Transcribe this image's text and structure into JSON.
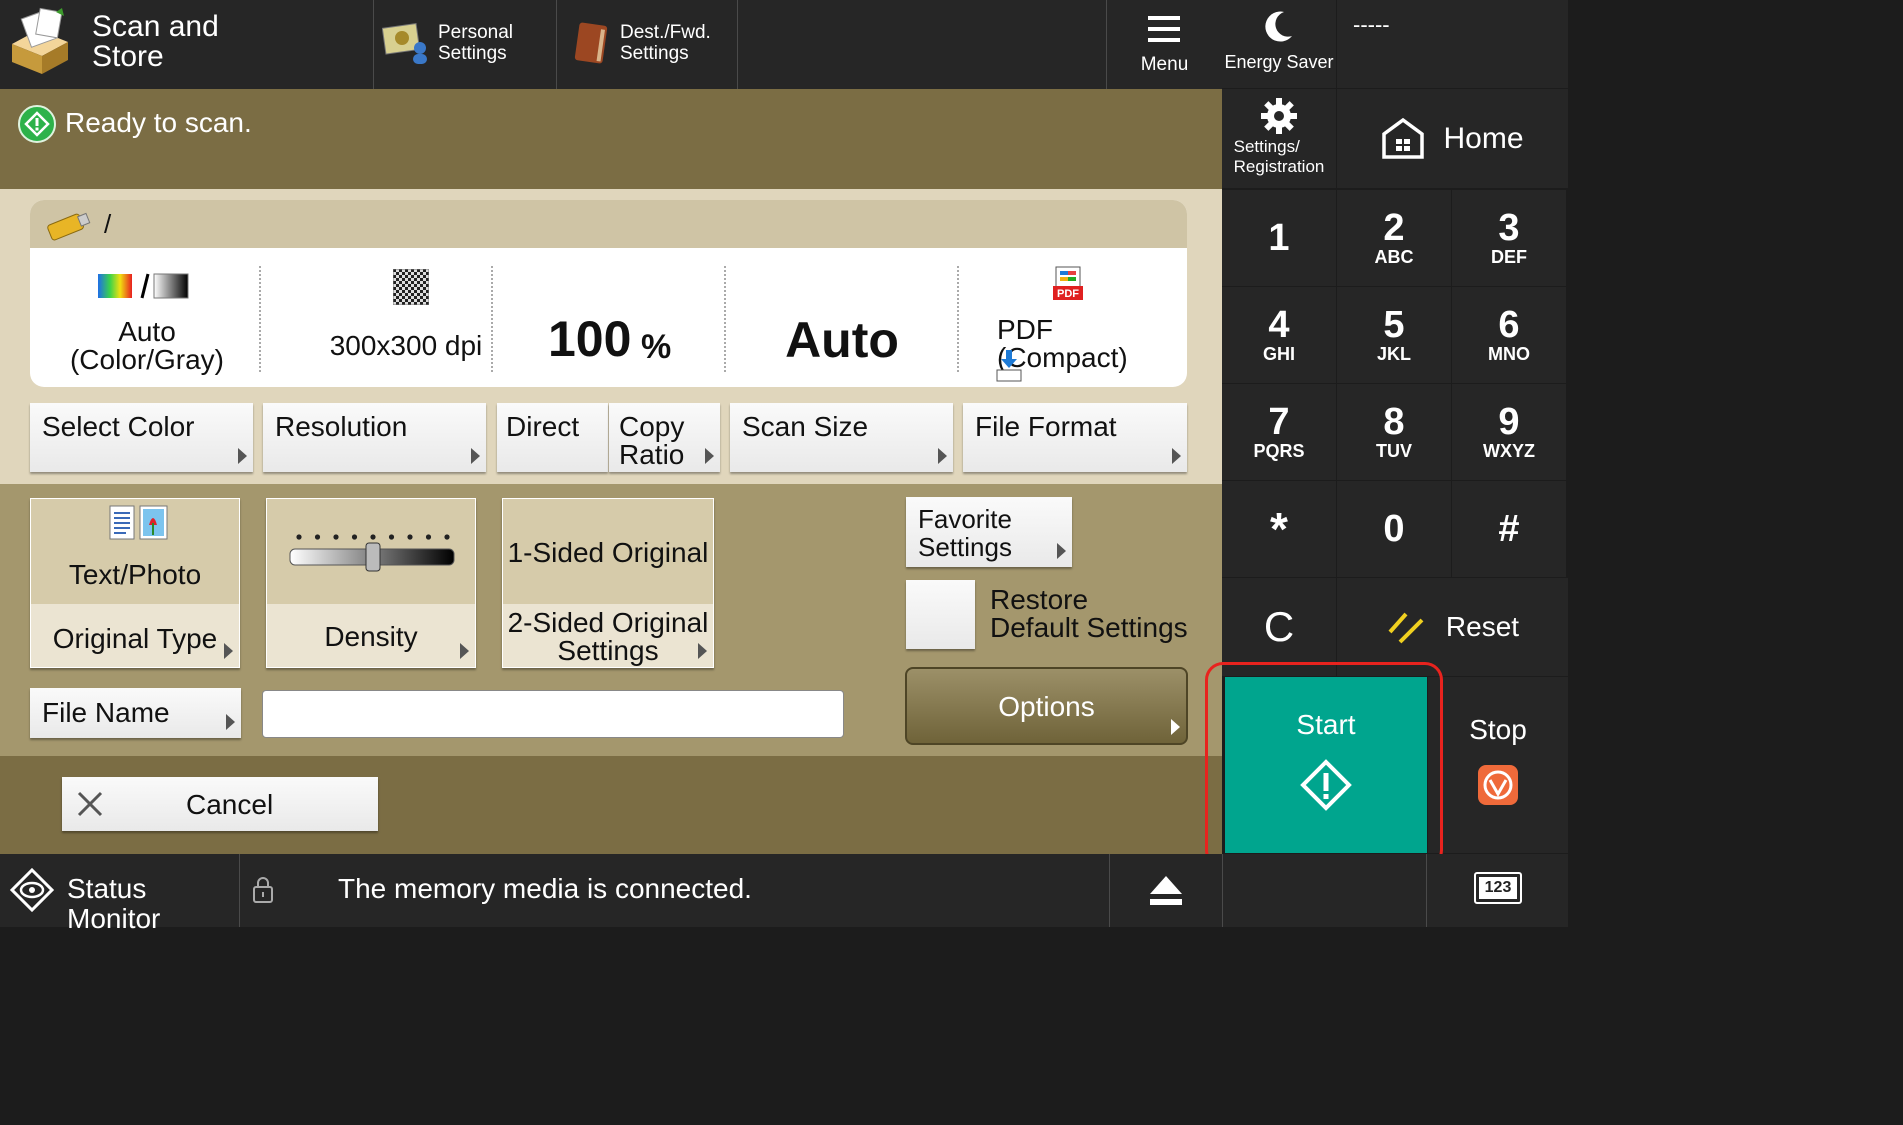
{
  "app_title": "Scan and\nStore",
  "header": {
    "personal_settings": "Personal\nSettings",
    "dest_fwd_settings": "Dest./Fwd.\nSettings",
    "menu": "Menu",
    "energy_saver": "Energy Saver",
    "user_field": "-----",
    "settings_registration": "Settings/\nRegistration",
    "home": "Home"
  },
  "status_message": "Ready to scan.",
  "path": "/",
  "summary": {
    "color": "Auto\n(Color/Gray)",
    "resolution": "300x300 dpi",
    "ratio_value": "100",
    "ratio_unit": "%",
    "scan_size": "Auto",
    "file_format": "PDF (Compact)"
  },
  "setting_buttons": {
    "select_color": "Select Color",
    "resolution": "Resolution",
    "direct": "Direct",
    "copy_ratio": "Copy\nRatio",
    "scan_size": "Scan Size",
    "file_format": "File Format"
  },
  "original_type": {
    "value": "Text/Photo",
    "label": "Original Type"
  },
  "density": {
    "label": "Density",
    "level": 0.5
  },
  "sided": {
    "value": "1-Sided Original",
    "label": "2-Sided Original\nSettings"
  },
  "favorite_settings": "Favorite\nSettings",
  "restore_default": "Restore\nDefault Settings",
  "file_name_button": "File Name",
  "file_name_value": "",
  "options": "Options",
  "cancel": "Cancel",
  "keypad": [
    {
      "n": "1",
      "s": ""
    },
    {
      "n": "2",
      "s": "ABC"
    },
    {
      "n": "3",
      "s": "DEF"
    },
    {
      "n": "4",
      "s": "GHI"
    },
    {
      "n": "5",
      "s": "JKL"
    },
    {
      "n": "6",
      "s": "MNO"
    },
    {
      "n": "7",
      "s": "PQRS"
    },
    {
      "n": "8",
      "s": "TUV"
    },
    {
      "n": "9",
      "s": "WXYZ"
    },
    {
      "n": "*",
      "s": ""
    },
    {
      "n": "0",
      "s": ""
    },
    {
      "n": "#",
      "s": ""
    }
  ],
  "clear": "C",
  "reset": "Reset",
  "start": "Start",
  "stop": "Stop",
  "status_monitor": "Status Monitor",
  "memory_message": "The memory media is connected.",
  "counter_label": "123",
  "colors": {
    "start": "#00a58e",
    "stop": "#ef6a3a",
    "highlight": "#e8231e",
    "panel": "#7b6d44"
  }
}
